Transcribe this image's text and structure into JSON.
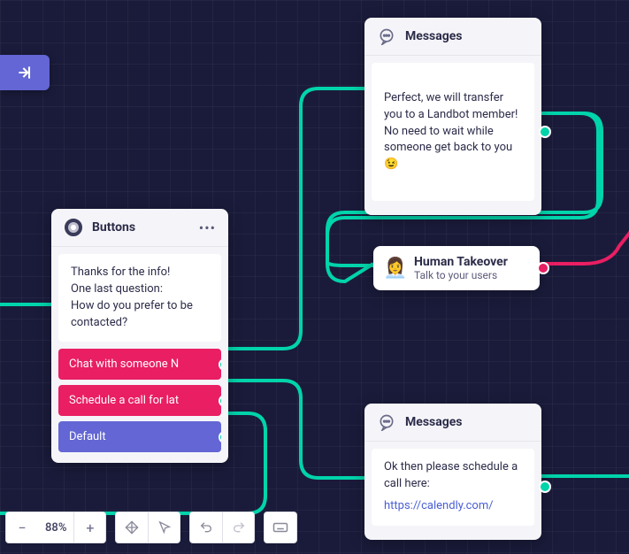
{
  "nodes": {
    "buttons": {
      "title": "Buttons",
      "body": "Thanks for the info!\nOne last question:\nHow do you prefer to be contacted?",
      "options": [
        {
          "label": "Chat with someone N",
          "color": "pink"
        },
        {
          "label": "Schedule a call for lat",
          "color": "pink"
        },
        {
          "label": "Default",
          "color": "purple"
        }
      ]
    },
    "messages_top": {
      "title": "Messages",
      "body": "Perfect, we will transfer you to a Landbot member!\nNo need to wait while someone get back to you 😉"
    },
    "human_takeover": {
      "title": "Human Takeover",
      "subtitle": "Talk to your users",
      "emoji": "👩‍💼"
    },
    "messages_bottom": {
      "title": "Messages",
      "body": "Ok then please schedule a call here:",
      "link": "https://calendly.com/"
    }
  },
  "toolbar": {
    "zoom": "88%"
  }
}
